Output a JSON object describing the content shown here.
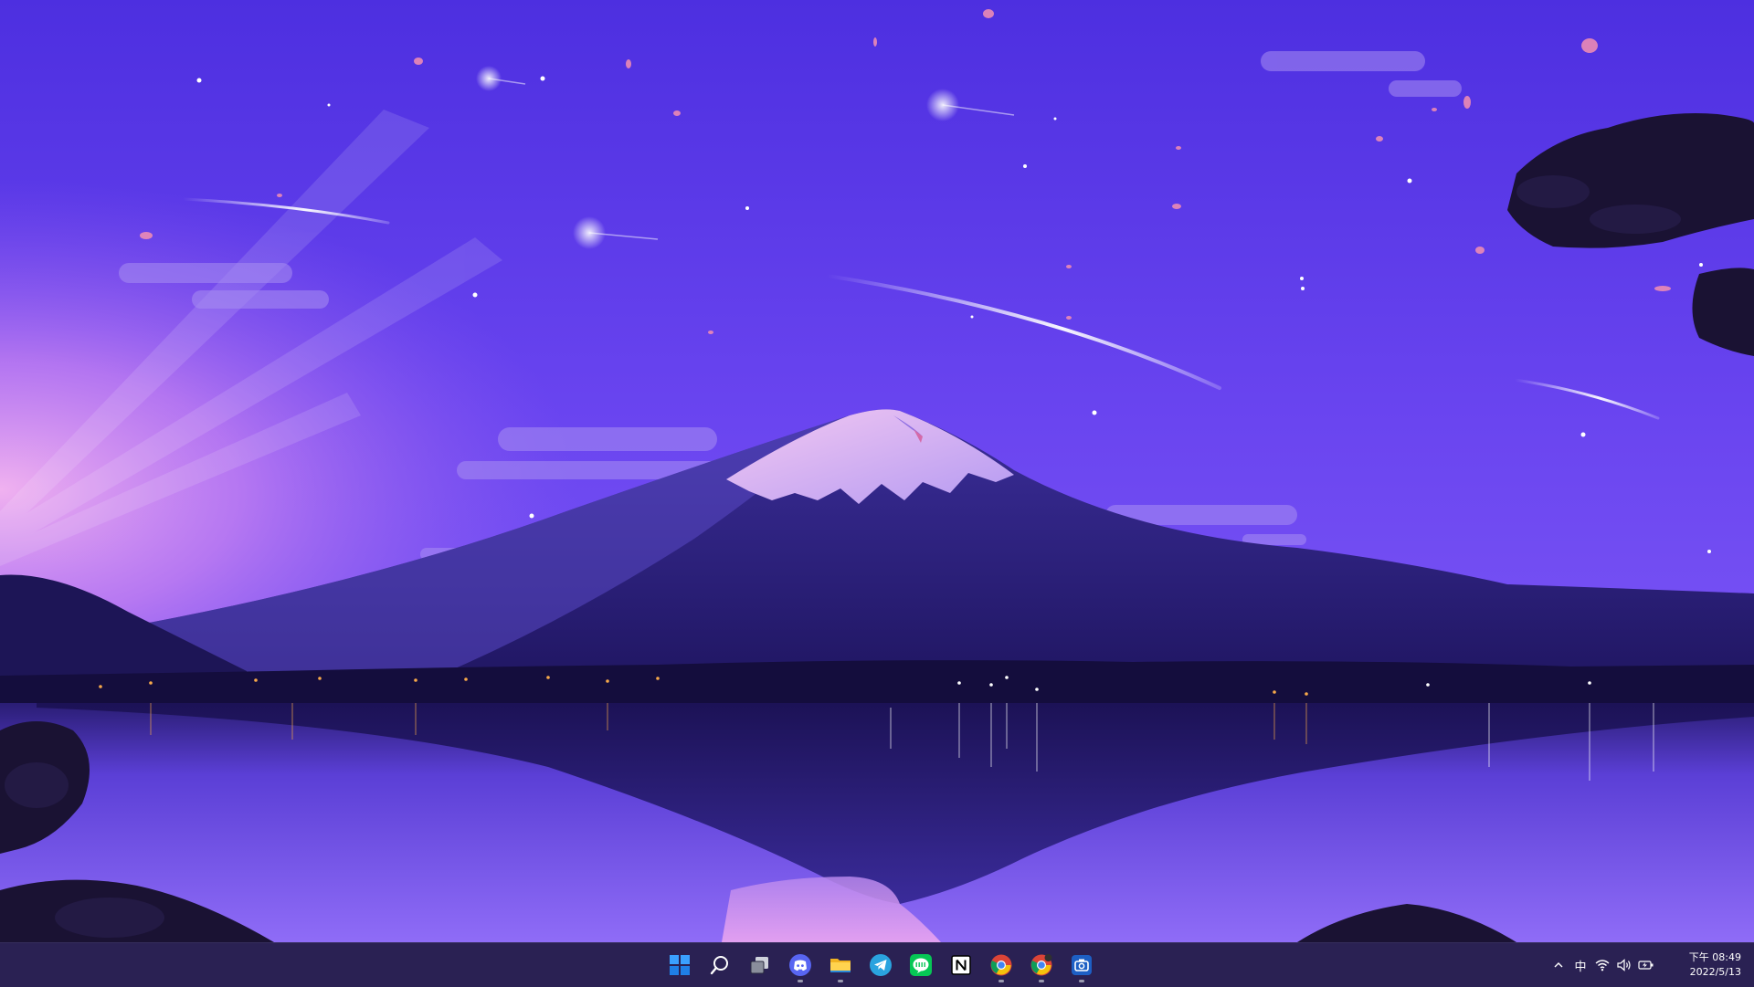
{
  "taskbar": {
    "apps": [
      {
        "name": "Start",
        "icon": "windows-start-icon",
        "running": false
      },
      {
        "name": "Search",
        "icon": "search-icon",
        "running": false
      },
      {
        "name": "Task View",
        "icon": "task-view-icon",
        "running": false
      },
      {
        "name": "Discord",
        "icon": "discord-icon",
        "running": true
      },
      {
        "name": "File Explorer",
        "icon": "folder-icon",
        "running": true
      },
      {
        "name": "Telegram",
        "icon": "telegram-icon",
        "running": false
      },
      {
        "name": "LINE",
        "icon": "line-icon",
        "running": false
      },
      {
        "name": "Notion",
        "icon": "notion-icon",
        "running": false
      },
      {
        "name": "Chrome",
        "icon": "chrome-icon",
        "running": true
      },
      {
        "name": "Chrome",
        "icon": "chrome-icon",
        "running": true
      },
      {
        "name": "Screen Capture",
        "icon": "camera-app-icon",
        "running": true
      }
    ],
    "tray": {
      "ime": "中",
      "time": "下午 08:49",
      "date": "2022/5/13"
    },
    "colors": {
      "background": "#261e46",
      "indicator": "#9a9ab0",
      "accent": "#0078d4"
    }
  }
}
